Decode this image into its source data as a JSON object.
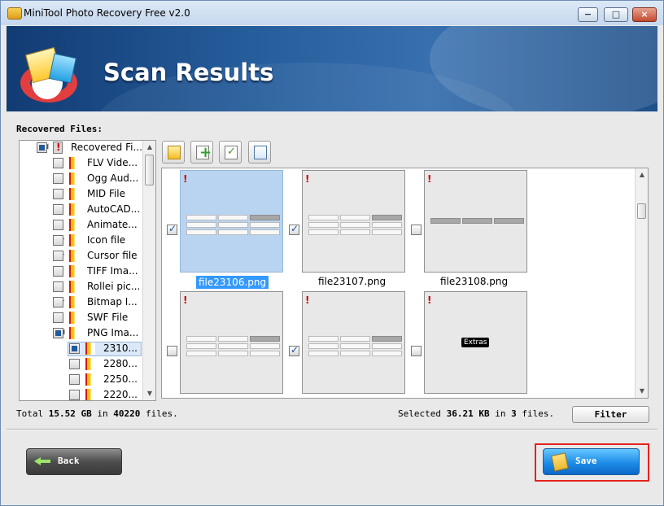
{
  "window": {
    "title": "MiniTool Photo Recovery Free v2.0",
    "controls": [
      "−",
      "□",
      "×"
    ]
  },
  "banner": {
    "title": "Scan Results"
  },
  "tree": {
    "label": "Recovered Files:",
    "items": [
      {
        "label": "Recovered Fi...",
        "level": 0,
        "checked": "partial",
        "expanded": true
      },
      {
        "label": "FLV Vide...",
        "level": 1,
        "checked": false
      },
      {
        "label": "Ogg Aud...",
        "level": 1,
        "checked": false
      },
      {
        "label": "MID File",
        "level": 1,
        "checked": false
      },
      {
        "label": "AutoCAD...",
        "level": 1,
        "checked": false
      },
      {
        "label": "Animate...",
        "level": 1,
        "checked": false
      },
      {
        "label": "Icon file",
        "level": 1,
        "checked": false,
        "collapsible": true
      },
      {
        "label": "Cursor file",
        "level": 1,
        "checked": false,
        "collapsible": true
      },
      {
        "label": "TIFF Ima...",
        "level": 1,
        "checked": false
      },
      {
        "label": "Rollei pic...",
        "level": 1,
        "checked": false
      },
      {
        "label": "Bitmap I...",
        "level": 1,
        "checked": false,
        "collapsible": true
      },
      {
        "label": "SWF File",
        "level": 1,
        "checked": false
      },
      {
        "label": "PNG Ima...",
        "level": 1,
        "checked": "partial",
        "expanded": true
      },
      {
        "label": "2310...",
        "level": 2,
        "checked": "partial",
        "selected": true
      },
      {
        "label": "2280...",
        "level": 2,
        "checked": false
      },
      {
        "label": "2250...",
        "level": 2,
        "checked": false
      },
      {
        "label": "2220...",
        "level": 2,
        "checked": false
      }
    ]
  },
  "toolbar": {
    "buttons": [
      "folder-up-icon",
      "add-icon",
      "check-all-icon",
      "view-menu-icon"
    ]
  },
  "thumbnails": [
    {
      "filename": "file23106.png",
      "checked": true,
      "selected": true,
      "preview": "table"
    },
    {
      "filename": "file23107.png",
      "checked": true,
      "selected": false,
      "preview": "table"
    },
    {
      "filename": "file23108.png",
      "checked": false,
      "selected": false,
      "preview": "tabs"
    },
    {
      "filename": "",
      "checked": false,
      "selected": false,
      "preview": "table"
    },
    {
      "filename": "",
      "checked": true,
      "selected": false,
      "preview": "table"
    },
    {
      "filename": "",
      "checked": false,
      "selected": false,
      "preview": "extras",
      "preview_text": "Extras"
    }
  ],
  "status": {
    "total_prefix": "Total",
    "total_size": "15.52",
    "total_unit": "GB",
    "total_in": "in",
    "total_files": "40220",
    "total_suffix": "files.",
    "selected_prefix": "Selected",
    "selected_size": "36.21",
    "selected_unit": "KB",
    "selected_in": "in",
    "selected_files": "3",
    "selected_suffix": "files."
  },
  "buttons": {
    "filter": "Filter",
    "back": "Back",
    "save": "Save"
  }
}
